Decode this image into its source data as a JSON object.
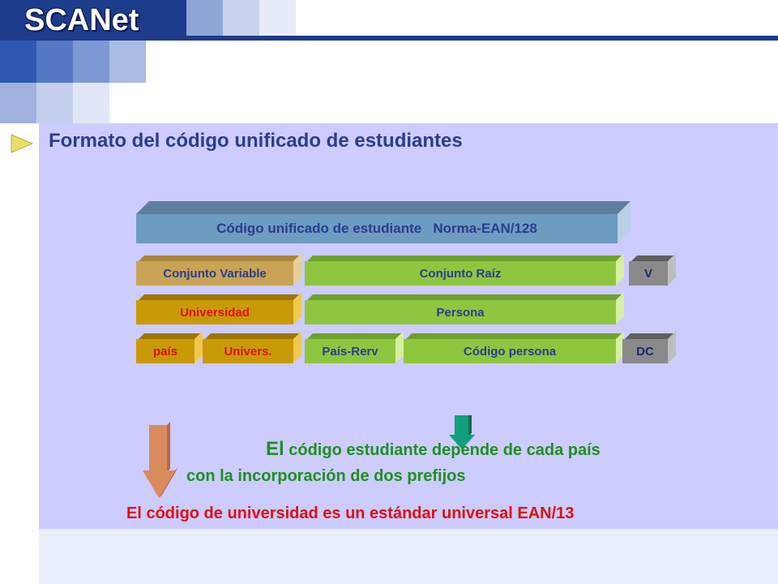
{
  "header": {
    "logo_text": "SCANet"
  },
  "slide": {
    "title": "Formato del código unificado de estudiantes"
  },
  "diagram": {
    "main_bar": "Código unificado de estudiante   Norma-EAN/128",
    "row1": {
      "conjunto_variable": "Conjunto Variable",
      "conjunto_raiz": "Conjunto Raíz",
      "v": "V"
    },
    "row2": {
      "universidad": "Universidad",
      "persona": "Persona"
    },
    "row3": {
      "pais": "país",
      "univers": "Univers.",
      "pais_rerv": "País-Rerv",
      "codigo_persona": "Código persona",
      "dc": "DC"
    }
  },
  "notes": {
    "line1_big": "El",
    "line1_rest": " código estudiante depende de cada país",
    "line2": "con la incorporación de dos prefijos",
    "line3": "El código de universidad es un estándar universal EAN/13"
  },
  "colors": {
    "title": "#2a3d8f",
    "steel_bar": "#6e9bc0",
    "tan_bar": "#c9a356",
    "gold_bar": "#c99a07",
    "green_bar": "#8ec63f",
    "gray_bar": "#8a8a8a",
    "note_green": "#1f8f1f",
    "note_red": "#e01010"
  }
}
